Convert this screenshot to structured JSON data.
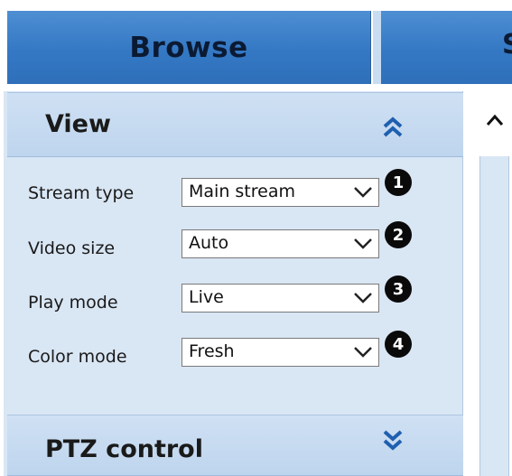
{
  "tabs": {
    "browse_label": "Browse",
    "second_label_partial": "S"
  },
  "sections": {
    "view": {
      "title": "View",
      "state": "expanded",
      "icon": "double-chevron-up-icon"
    },
    "ptz": {
      "title": "PTZ control",
      "state": "collapsed",
      "icon": "double-chevron-down-icon"
    }
  },
  "fields": [
    {
      "label": "Stream type",
      "value": "Main stream",
      "badge": "1"
    },
    {
      "label": "Video size",
      "value": "Auto",
      "badge": "2"
    },
    {
      "label": "Play mode",
      "value": "Live",
      "badge": "3"
    },
    {
      "label": "Color mode",
      "value": "Fresh",
      "badge": "4"
    }
  ],
  "colors": {
    "tab_blue": "#3478c4",
    "panel_bg": "#d9e6f4",
    "header_bg": "#c4d9f0",
    "chevron_blue": "#1f5fb0"
  }
}
